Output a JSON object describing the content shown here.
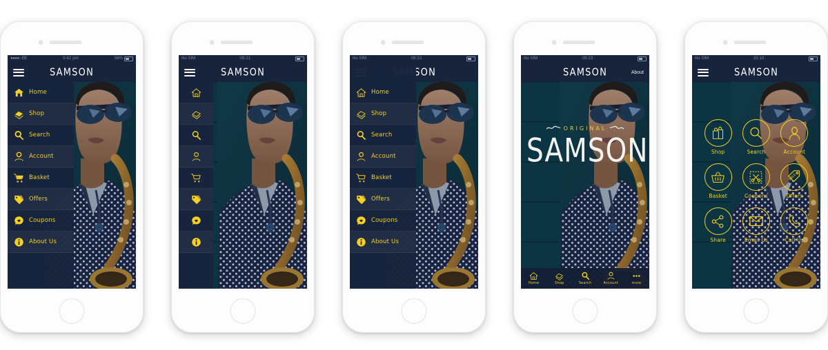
{
  "colors": {
    "accent_yellow": "#f5d022",
    "navy_bar": "#18243c",
    "drawer_navy": "#17243d",
    "screen_bg": "#0f1b30",
    "frame_white": "#fdfdfd",
    "hero_title_white": "#f3f4f2"
  },
  "brand": "SAMSON",
  "menu_items": [
    {
      "label": "Home",
      "icon": "home-icon"
    },
    {
      "label": "Shop",
      "icon": "shop-icon"
    },
    {
      "label": "Search",
      "icon": "search-icon"
    },
    {
      "label": "Account",
      "icon": "account-icon"
    },
    {
      "label": "Basket",
      "icon": "basket-cart-icon"
    },
    {
      "label": "Offers",
      "icon": "offers-tag-icon"
    },
    {
      "label": "Coupons",
      "icon": "coupons-heart-icon"
    },
    {
      "label": "About Us",
      "icon": "info-icon"
    }
  ],
  "phones": [
    {
      "id": "phone-1",
      "variant": "drawer-labels",
      "status": {
        "carrier": "●●●●○ EE",
        "time": "3:42 pm",
        "battery": "56%"
      },
      "appbar": {
        "title": "SAMSON",
        "menu_icon": "hamburger-icon",
        "action": ""
      }
    },
    {
      "id": "phone-2",
      "variant": "drawer-icons",
      "status": {
        "carrier": "No SIM",
        "time": "09:21",
        "battery": ""
      },
      "appbar": {
        "title": "SAMSON",
        "menu_icon": "hamburger-icon",
        "action": ""
      }
    },
    {
      "id": "phone-3",
      "variant": "drawer-labels-over",
      "status": {
        "carrier": "No SIM",
        "time": "09:22",
        "battery": ""
      },
      "appbar": {
        "title": "SAMSON",
        "menu_icon": "hamburger-icon",
        "action": ""
      }
    },
    {
      "id": "phone-4",
      "variant": "hero",
      "status": {
        "carrier": "No SIM",
        "time": "09:23",
        "battery": ""
      },
      "appbar": {
        "title": "SAMSON",
        "menu_icon": "",
        "action": "About"
      },
      "hero": {
        "kicker": "ORIGINAL",
        "title": "SAMSON"
      },
      "tabbar": [
        {
          "label": "Home",
          "icon": "home-icon"
        },
        {
          "label": "Shop",
          "icon": "shop-icon"
        },
        {
          "label": "Search",
          "icon": "search-icon"
        },
        {
          "label": "Account",
          "icon": "account-icon"
        },
        {
          "label": "more",
          "icon": "more-dots-icon"
        }
      ]
    },
    {
      "id": "phone-5",
      "variant": "grid",
      "status": {
        "carrier": "No SIM",
        "time": "15:10",
        "battery": ""
      },
      "appbar": {
        "title": "SAMSON",
        "menu_icon": "hamburger-icon",
        "action": ""
      },
      "grid": [
        [
          {
            "label": "Shop",
            "icon": "shop-bag-icon"
          },
          {
            "label": "Search",
            "icon": "search-icon"
          },
          {
            "label": "Account",
            "icon": "account-icon"
          }
        ],
        [
          {
            "label": "Basket",
            "icon": "basket-icon"
          },
          {
            "label": "Coupons",
            "icon": "coupon-scissors-icon"
          },
          {
            "label": "Offers",
            "icon": "sale-tag-icon"
          }
        ],
        [
          {
            "label": "Share",
            "icon": "share-nodes-icon"
          },
          {
            "label": "Email Us",
            "icon": "envelope-icon"
          },
          {
            "label": "Call Us",
            "icon": "phone-icon"
          }
        ]
      ]
    }
  ]
}
